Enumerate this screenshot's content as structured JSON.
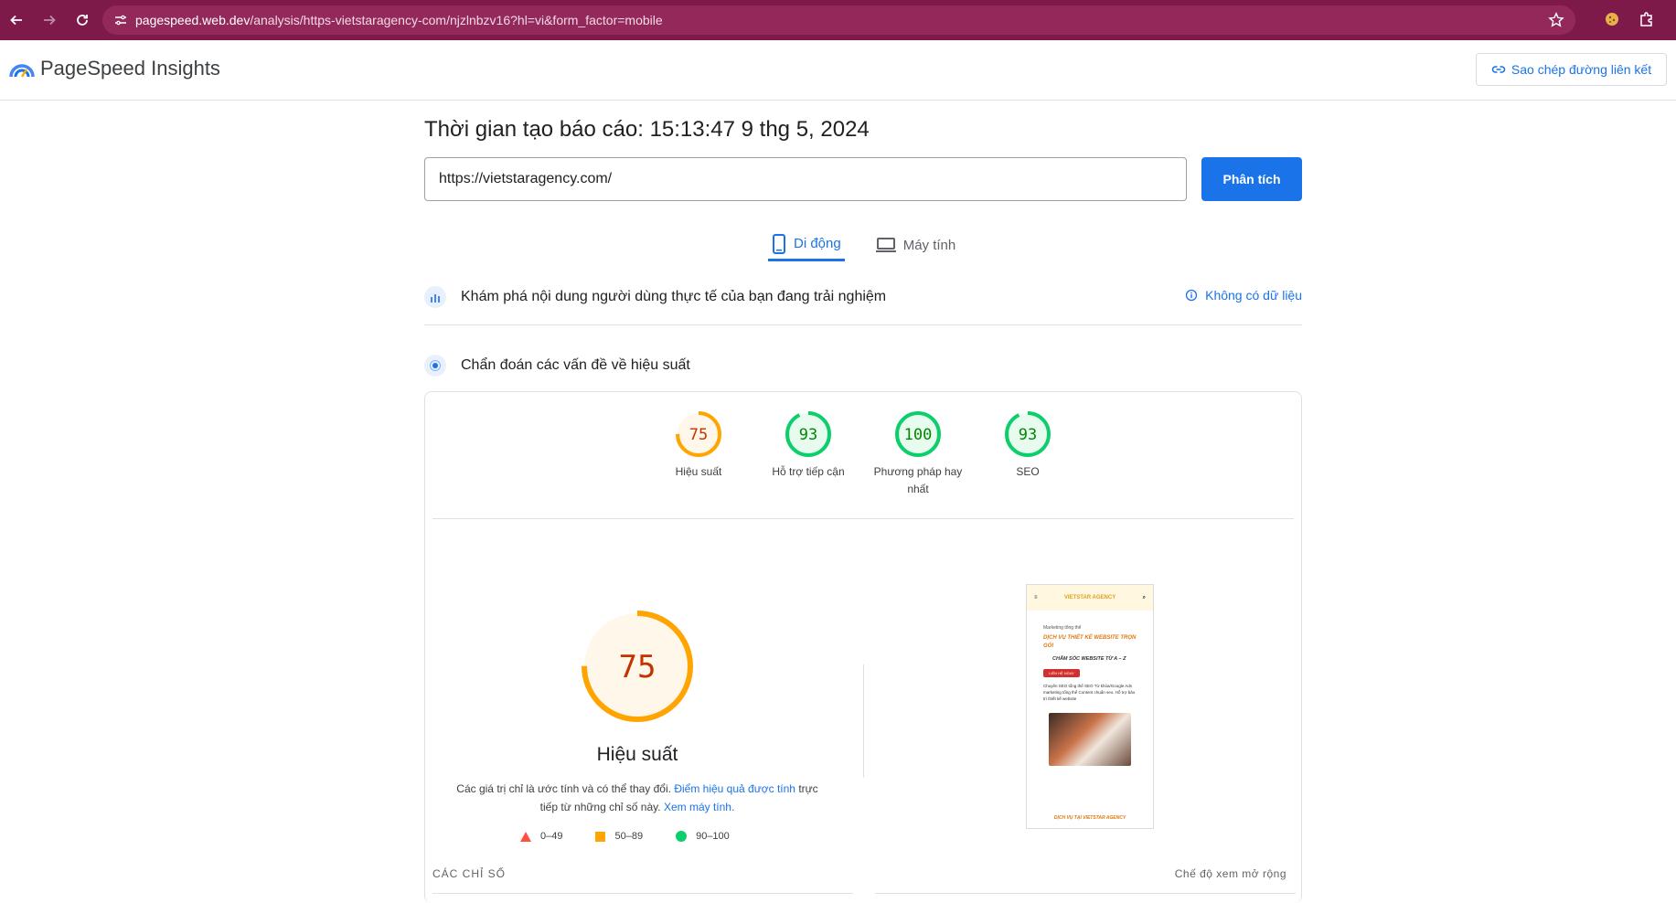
{
  "browser": {
    "url_domain": "pagespeed.web.dev",
    "url_path": "/analysis/https-vietstaragency-com/njzlnbzv16?hl=vi&form_factor=mobile"
  },
  "app": {
    "title": "PageSpeed Insights",
    "copy_link_label": "Sao chép đường liên kết"
  },
  "report": {
    "time_label": "Thời gian tạo báo cáo: 15:13:47 9 thg 5, 2024",
    "url_value": "https://vietstaragency.com/",
    "analyze_label": "Phân tích"
  },
  "tabs": [
    {
      "label": "Di động",
      "active": true
    },
    {
      "label": "Máy tính",
      "active": false
    }
  ],
  "field_data": {
    "text": "Khám phá nội dung người dùng thực tế của bạn đang trải nghiệm",
    "no_data_label": "Không có dữ liệu"
  },
  "diagnose": {
    "text": "Chẩn đoán các vấn đề về hiệu suất"
  },
  "scores": [
    {
      "value": "75",
      "label": "Hiệu suất",
      "status": "average",
      "color": "#ffa400",
      "fraction": 0.75
    },
    {
      "value": "93",
      "label": "Hỗ trợ tiếp cận",
      "status": "good",
      "color": "#0cce6b",
      "fraction": 0.93
    },
    {
      "value": "100",
      "label": "Phương pháp hay nhất",
      "status": "good",
      "color": "#0cce6b",
      "fraction": 1.0
    },
    {
      "value": "93",
      "label": "SEO",
      "status": "good",
      "color": "#0cce6b",
      "fraction": 0.93
    }
  ],
  "performance": {
    "score": "75",
    "fraction": 0.75,
    "label": "Hiệu suất",
    "desc_part1": "Các giá trị chỉ là ước tính và có thể thay đổi.",
    "desc_link1": "Điểm hiệu quả được tính",
    "desc_part2": "trực tiếp từ những chỉ số này.",
    "desc_link2": "Xem máy tính."
  },
  "legend": [
    {
      "range": "0–49",
      "shape": "triangle",
      "color": "#ff4e42"
    },
    {
      "range": "50–89",
      "shape": "square",
      "color": "#ffa400"
    },
    {
      "range": "90–100",
      "shape": "circle",
      "color": "#0cce6b"
    }
  ],
  "screenshot": {
    "brand": "VIETSTAR AGENCY",
    "tagline": "Marketing tổng thể",
    "title": "DỊCH VỤ THIẾT KẾ WEBSITE TRỌN GÓI",
    "subtitle": "CHĂM SÓC WEBSITE TỪ A – Z",
    "cta": "LIÊN HỆ NGAY",
    "para": "Chuyên SEO tổng thể SEO Từ khóa/Google Ads marketing tổng thể Content chuẩn seo. Hỗ trợ bảo trì thiết kế website",
    "footer": "DỊCH VỤ TẠI VIETSTAR AGENCY"
  },
  "metrics": {
    "label": "CÁC CHỈ SỐ",
    "expand_label": "Chế độ xem mở rộng"
  }
}
